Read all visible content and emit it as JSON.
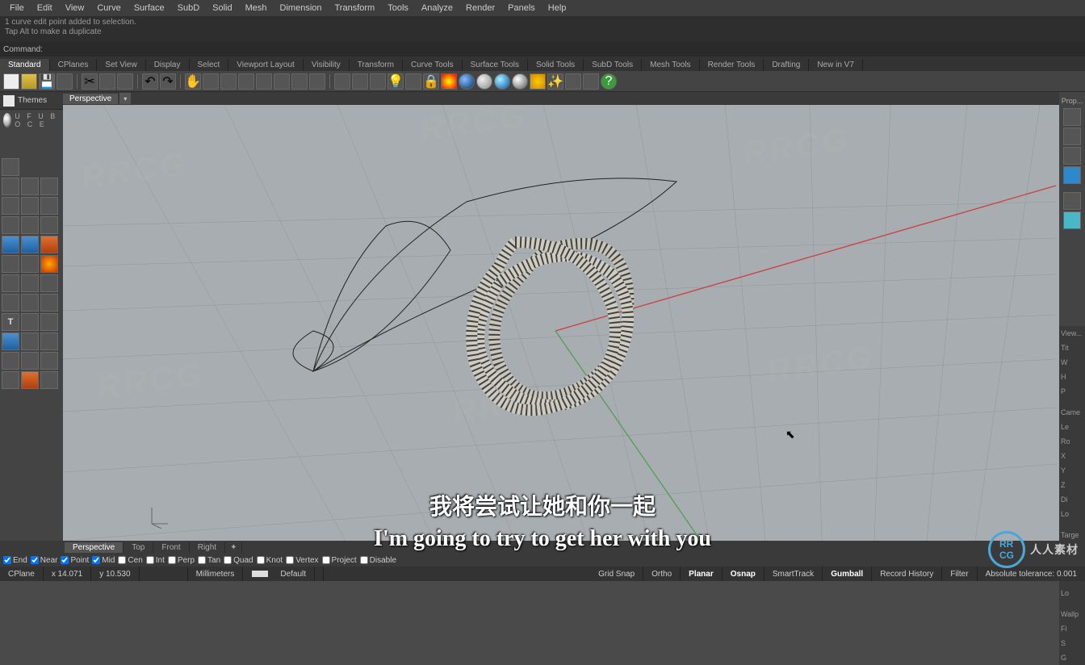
{
  "menu": [
    "File",
    "Edit",
    "View",
    "Curve",
    "Surface",
    "SubD",
    "Solid",
    "Mesh",
    "Dimension",
    "Transform",
    "Tools",
    "Analyze",
    "Render",
    "Panels",
    "Help"
  ],
  "history": {
    "line1": "1 curve edit point added to selection.",
    "line2": "Tap Alt to make a duplicate"
  },
  "command_label": "Command:",
  "tabs": [
    "Standard",
    "CPlanes",
    "Set View",
    "Display",
    "Select",
    "Viewport Layout",
    "Visibility",
    "Transform",
    "Curve Tools",
    "Surface Tools",
    "Solid Tools",
    "SubD Tools",
    "Mesh Tools",
    "Render Tools",
    "Drafting",
    "New in V7"
  ],
  "themes_label": "Themes",
  "ufuboce": "U F U B O C E",
  "viewport_tab": "Perspective",
  "right_labels": {
    "prop": "Prop...",
    "view": "View...",
    "tit": "Tit",
    "w": "W",
    "h": "H",
    "p": "P",
    "came": "Came",
    "le": "Le",
    "ro": "Ro",
    "x": "X",
    "y": "Y",
    "z": "Z",
    "di": "Di",
    "lo": "Lo",
    "targe": "Targe",
    "wallp": "Wallp",
    "fi": "Fi",
    "s": "S",
    "g": "G"
  },
  "bottom_tabs": [
    "Perspective",
    "Top",
    "Front",
    "Right"
  ],
  "osnap": [
    {
      "label": "End",
      "checked": true
    },
    {
      "label": "Near",
      "checked": true
    },
    {
      "label": "Point",
      "checked": true
    },
    {
      "label": "Mid",
      "checked": true
    },
    {
      "label": "Cen",
      "checked": false
    },
    {
      "label": "Int",
      "checked": false
    },
    {
      "label": "Perp",
      "checked": false
    },
    {
      "label": "Tan",
      "checked": false
    },
    {
      "label": "Quad",
      "checked": false
    },
    {
      "label": "Knot",
      "checked": false
    },
    {
      "label": "Vertex",
      "checked": false
    },
    {
      "label": "Project",
      "checked": false
    },
    {
      "label": "Disable",
      "checked": false
    }
  ],
  "status": {
    "cplane": "CPlane",
    "x": "x 14.071",
    "y": "y 10.530",
    "z": "",
    "mm": "Millimeters",
    "layer": "Default",
    "items": [
      "Grid Snap",
      "Ortho",
      "Planar",
      "Osnap",
      "SmartTrack",
      "Gumball",
      "Record History",
      "Filter"
    ],
    "active": [
      "Planar",
      "Osnap",
      "Gumball"
    ],
    "tol": "Absolute tolerance: 0.001"
  },
  "subtitles": {
    "cn": "我将尝试让她和你一起",
    "en": "I'm going to try to get her with you"
  },
  "logo": "人人素材"
}
